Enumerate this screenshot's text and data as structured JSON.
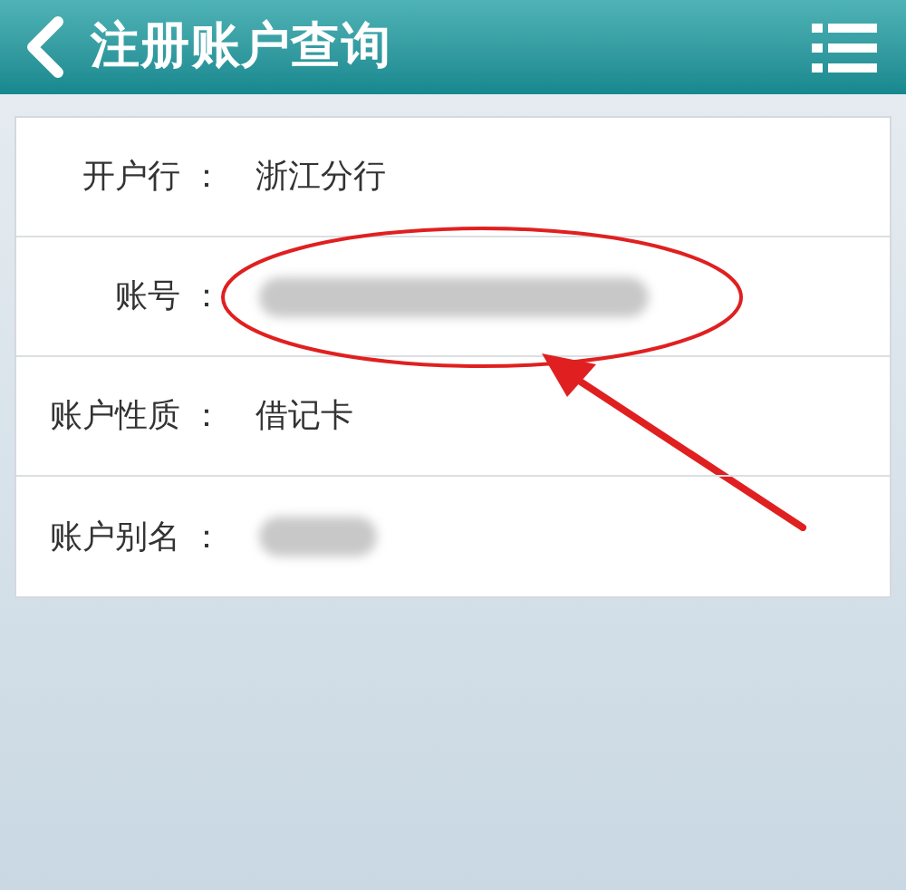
{
  "header": {
    "title": "注册账户查询"
  },
  "rows": [
    {
      "label": "开户行 ：",
      "value": "浙江分行",
      "redacted": false
    },
    {
      "label": "账号 ：",
      "redacted": true,
      "highlighted": true
    },
    {
      "label": "账户性质 ：",
      "value": "借记卡",
      "redacted": false
    },
    {
      "label": "账户别名 ：",
      "redacted": true,
      "highlighted": false
    }
  ]
}
